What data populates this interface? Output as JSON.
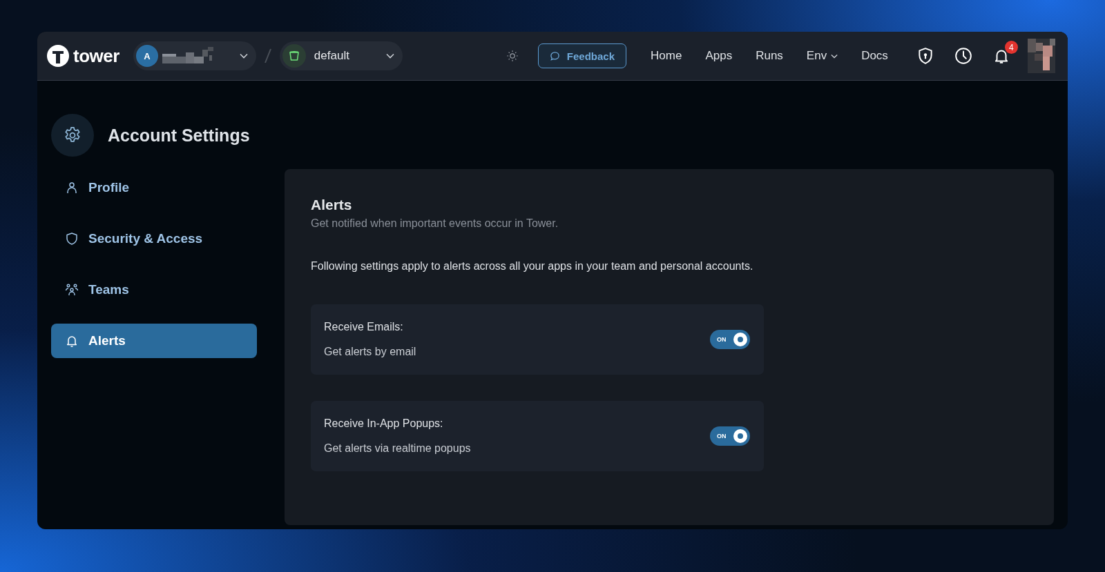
{
  "brand": "tower",
  "org": {
    "initial": "A"
  },
  "environment": {
    "name": "default"
  },
  "feedback": "Feedback",
  "nav": [
    {
      "label": "Home",
      "dropdown": false
    },
    {
      "label": "Apps",
      "dropdown": false
    },
    {
      "label": "Runs",
      "dropdown": false
    },
    {
      "label": "Env",
      "dropdown": true
    },
    {
      "label": "Docs",
      "dropdown": false
    }
  ],
  "notifications": {
    "count": "4"
  },
  "sidebar": {
    "title": "Account Settings",
    "items": [
      {
        "label": "Profile",
        "kind": "person",
        "selected": false
      },
      {
        "label": "Security & Access",
        "kind": "shield",
        "selected": false
      },
      {
        "label": "Teams",
        "kind": "team",
        "selected": false
      },
      {
        "label": "Alerts",
        "kind": "bell",
        "selected": true
      }
    ]
  },
  "panel": {
    "title": "Alerts",
    "subtitle": "Get notified when important events occur in Tower.",
    "intro": "Following settings apply to alerts across all your apps in your team and personal accounts.",
    "settings": [
      {
        "label": "Receive Emails:",
        "description": "Get alerts by email",
        "toggle": "ON",
        "on": true
      },
      {
        "label": "Receive In-App Popups:",
        "description": "Get alerts via realtime popups",
        "toggle": "ON",
        "on": true
      }
    ]
  }
}
